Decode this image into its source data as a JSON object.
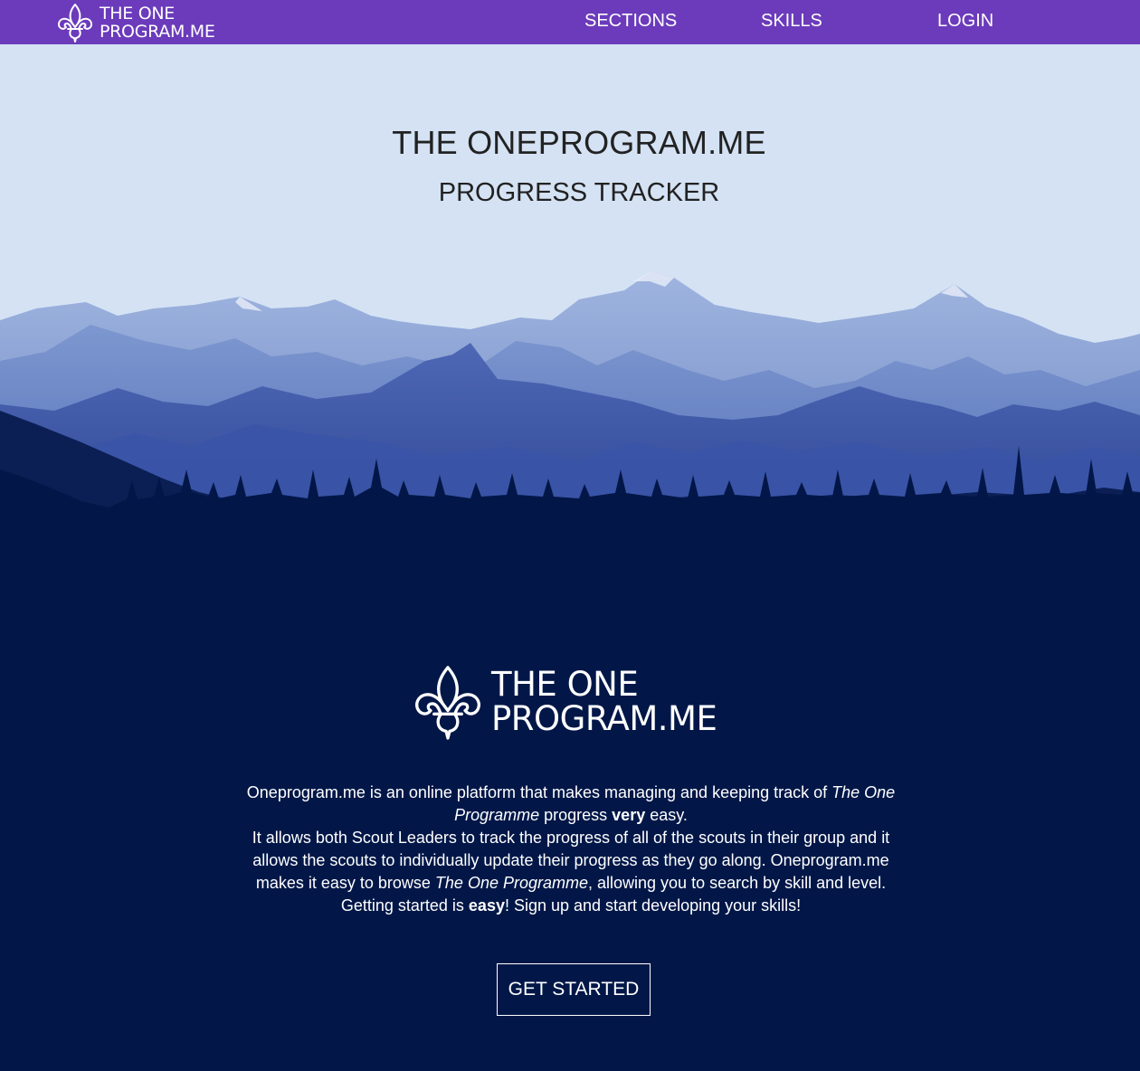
{
  "header": {
    "brand": {
      "line1": "THE ONE",
      "line2": "PROGRAM.ME",
      "icon": "fleur-de-lis-icon"
    },
    "nav": [
      {
        "label": "SECTIONS"
      },
      {
        "label": "SKILLS"
      },
      {
        "label": "LOGIN"
      }
    ],
    "background": "#6b3bbb"
  },
  "hero": {
    "title": "THE ONEPROGRAM.ME",
    "subtitle": "PROGRESS TRACKER",
    "background": "#d4e2f4"
  },
  "main": {
    "logo": {
      "line1": "THE ONE",
      "line2": "PROGRAM.ME",
      "icon": "fleur-de-lis-icon"
    },
    "intro": {
      "p1_start": "Oneprogram.me is an online platform that makes managing and keeping track of ",
      "p1_em": "The One Programme",
      "p1_mid": " progress ",
      "p1_strong": "very",
      "p1_end": " easy.",
      "p2_start": "It allows both Scout Leaders to track the progress of all of the scouts in their group and it allows the scouts to individually update their progress as they go along. Oneprogram.me makes it easy to browse ",
      "p2_em": "The One Programme",
      "p2_end": ", allowing you to search by skill and level.",
      "p3_start": "Getting started is ",
      "p3_strong": "easy",
      "p3_end": "! Sign up and start developing your skills!"
    },
    "cta_label": "GET STARTED",
    "background": "#021748"
  }
}
